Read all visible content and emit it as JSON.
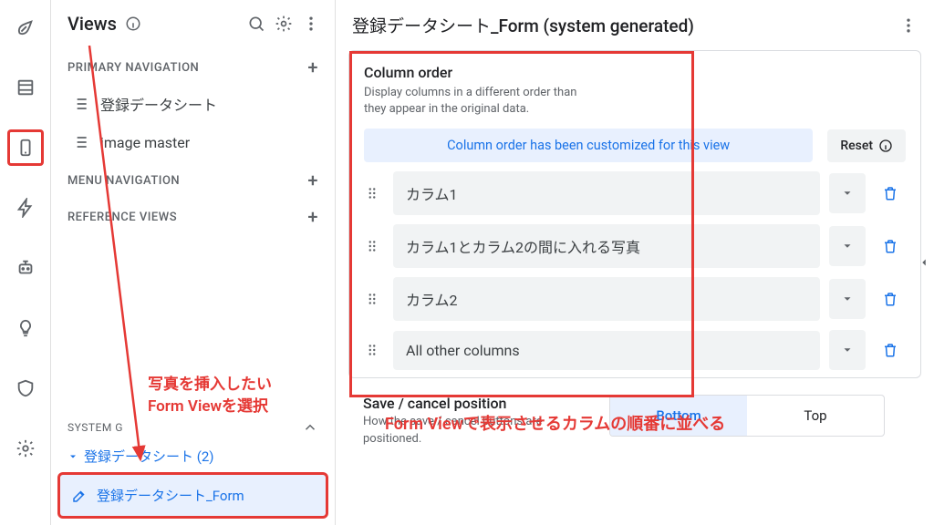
{
  "rail": {
    "items": [
      "rocket",
      "data",
      "smartphone",
      "bolt",
      "bot",
      "lightbulb",
      "shield",
      "gear"
    ],
    "selected_index": 2
  },
  "side": {
    "title": "Views",
    "sections": {
      "primary": {
        "heading": "PRIMARY NAVIGATION",
        "items": [
          "登録データシート",
          "image master"
        ]
      },
      "menu": {
        "heading": "MENU NAVIGATION"
      },
      "reference": {
        "heading": "REFERENCE VIEWS"
      }
    },
    "system": {
      "heading": "SYSTEM G",
      "group_label": "登録データシート (2)",
      "item_label": "登録データシート_Form"
    }
  },
  "main": {
    "title": "登録データシート_Form (system generated)",
    "column_order": {
      "title": "Column order",
      "desc": "Display columns in a different order than they appear in the original data.",
      "notice": "Column order has been customized for this view",
      "reset_label": "Reset",
      "rows": [
        "カラム1",
        "カラム1とカラム2の間に入れる写真",
        "カラム2",
        "All other columns"
      ]
    },
    "save_cancel": {
      "title": "Save / cancel position",
      "desc": "How the save / cancel buttons are positioned.",
      "options": [
        "Bottom",
        "Top"
      ],
      "selected": "Bottom"
    }
  },
  "annotations": {
    "left_line1": "写真を挿入したい",
    "left_line2": "Form Viewを選択",
    "right": "Form Viewで表示させるカラムの順番に並べる"
  }
}
